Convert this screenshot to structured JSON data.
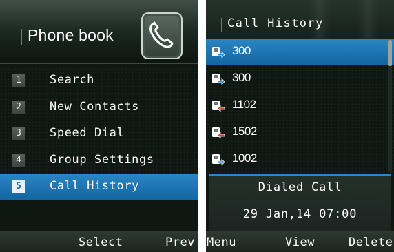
{
  "left_screen": {
    "title": "Phone book",
    "header_icon": "phone-book-icon",
    "menu": [
      {
        "number": "1",
        "label": "Search",
        "selected": false
      },
      {
        "number": "2",
        "label": "New Contacts",
        "selected": false
      },
      {
        "number": "3",
        "label": "Speed Dial",
        "selected": false
      },
      {
        "number": "4",
        "label": "Group Settings",
        "selected": false
      },
      {
        "number": "5",
        "label": "Call History",
        "selected": true
      }
    ],
    "softkeys": {
      "center": "Select",
      "right": "Prev"
    }
  },
  "right_screen": {
    "title": "Call History",
    "calls": [
      {
        "number": "300",
        "type": "dialed",
        "icon": "dialed-call-icon",
        "selected": true
      },
      {
        "number": "300",
        "type": "dialed",
        "icon": "dialed-call-icon",
        "selected": false
      },
      {
        "number": "1102",
        "type": "received",
        "icon": "received-call-icon",
        "selected": false
      },
      {
        "number": "1502",
        "type": "received",
        "icon": "received-call-icon",
        "selected": false
      },
      {
        "number": "1002",
        "type": "dialed",
        "icon": "dialed-call-icon",
        "selected": false
      }
    ],
    "detail": {
      "call_type": "Dialed Call",
      "datetime": "29 Jan,14 07:00"
    },
    "softkeys": {
      "left": "Menu",
      "center": "View",
      "right": "Delete"
    }
  },
  "colors": {
    "selection": "#1d78b8",
    "background": "#0f1712",
    "text": "#ffffff",
    "dialed_arrow": "#2a8fd8",
    "received_arrow": "#d83a2a"
  }
}
